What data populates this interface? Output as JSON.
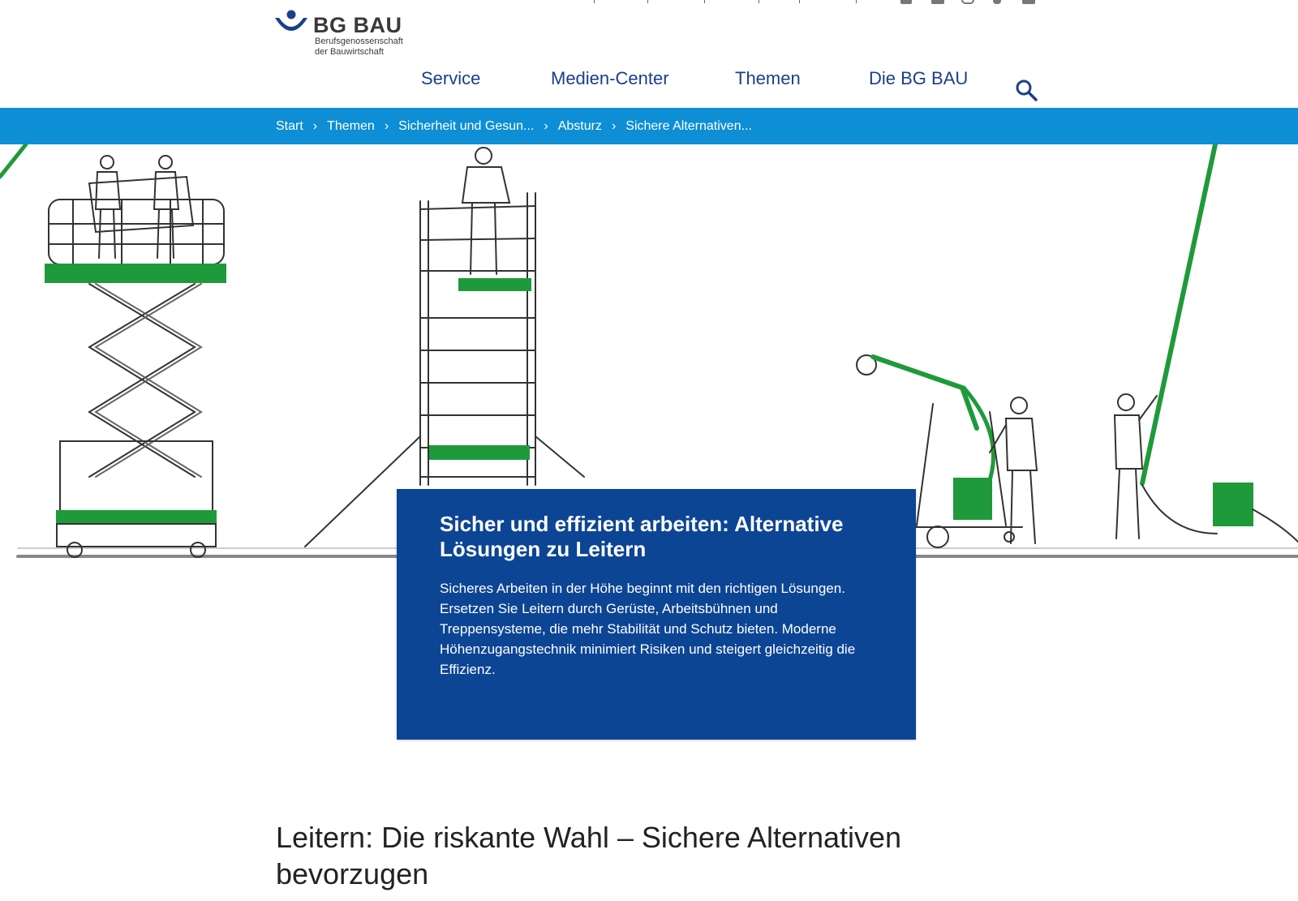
{
  "logo": {
    "name": "BG BAU",
    "subline_1": "Berufsgenossenschaft",
    "subline_2": "der Bauwirtschaft"
  },
  "colors": {
    "brand_blue": "#1b3e8c",
    "bar_blue": "#0e8ed4",
    "card_blue": "#0d4595",
    "accent_green": "#1f9a3a"
  },
  "nav": {
    "items": [
      "Service",
      "Medien-Center",
      "Themen",
      "Die BG BAU"
    ],
    "search_icon": "search-icon"
  },
  "breadcrumb": {
    "items": [
      "Start",
      "Themen",
      "Sicherheit und Gesun...",
      "Absturz",
      "Sichere Alternativen..."
    ],
    "separator": "›"
  },
  "teaser": {
    "title": "Sicher und effizient arbeiten: Alternative Lösungen zu Leitern",
    "text": "Sicheres Arbeiten in der Höhe beginnt mit den richtigen Lösungen. Ersetzen Sie Leitern durch Gerüste, Arbeitsbühnen und Treppensysteme, die mehr Stabilität und Schutz bieten. Moderne Höhenzugangstechnik minimiert Risiken und steigert gleichzeitig die Effizienz."
  },
  "headline": "Leitern: Die riskante Wahl – Sichere Alternativen bevorzugen"
}
